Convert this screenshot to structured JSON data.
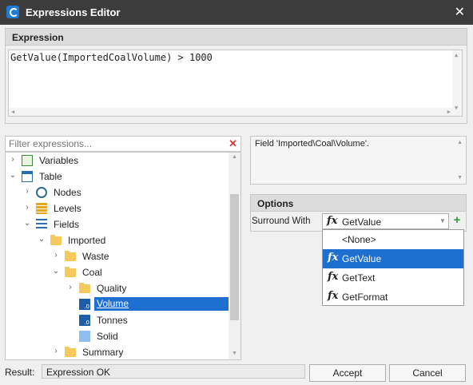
{
  "window": {
    "title": "Expressions Editor",
    "close_glyph": "✕"
  },
  "expression": {
    "header": "Expression",
    "text": "GetValue(ImportedCoalVolume) > 1000"
  },
  "filter": {
    "placeholder": "Filter expressions...",
    "clear_glyph": "✕"
  },
  "tree": {
    "items": [
      {
        "label": "Variables",
        "icon": "variables-icon"
      },
      {
        "label": "Table",
        "icon": "table-icon"
      },
      {
        "label": "Nodes",
        "icon": "nodes-icon"
      },
      {
        "label": "Levels",
        "icon": "levels-icon"
      },
      {
        "label": "Fields",
        "icon": "fields-icon"
      },
      {
        "label": "Imported",
        "icon": "folder-open-icon"
      },
      {
        "label": "Waste",
        "icon": "folder-icon"
      },
      {
        "label": "Coal",
        "icon": "folder-open-icon"
      },
      {
        "label": "Quality",
        "icon": "folder-icon"
      },
      {
        "label": "Volume",
        "icon": "numeric-field-icon",
        "selected": true
      },
      {
        "label": "Tonnes",
        "icon": "numeric-field-icon"
      },
      {
        "label": "Solid",
        "icon": "solid-icon"
      },
      {
        "label": "Summary",
        "icon": "folder-icon"
      }
    ]
  },
  "description": {
    "text": "Field 'Imported\\Coal\\Volume'."
  },
  "options": {
    "header": "Options",
    "surround_label": "Surround With",
    "surround_value": "GetValue",
    "dropdown_items": [
      {
        "label": "<None>",
        "has_fx": false
      },
      {
        "label": "GetValue",
        "has_fx": true,
        "selected": true
      },
      {
        "label": "GetText",
        "has_fx": true
      },
      {
        "label": "GetFormat",
        "has_fx": true
      }
    ]
  },
  "status": {
    "result_label": "Result:",
    "result_text": "Expression OK",
    "accept_label": "Accept",
    "cancel_label": "Cancel"
  },
  "colors": {
    "selection": "#1f6fd0",
    "titlebar": "#3c3c3c",
    "add_button": "#2e9b3c",
    "clear_button": "#d23c3c"
  }
}
